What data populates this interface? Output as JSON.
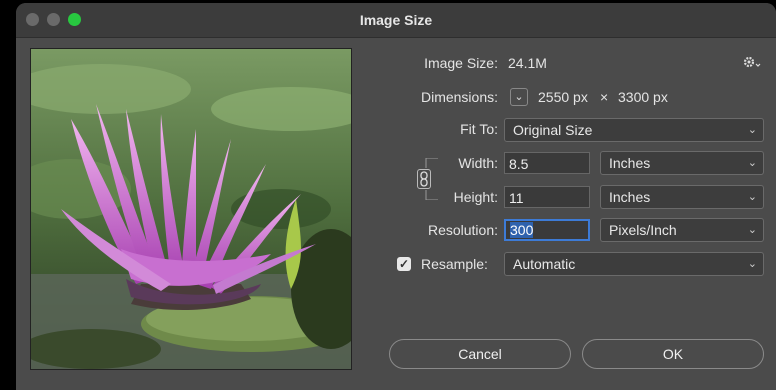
{
  "window": {
    "title": "Image Size"
  },
  "info": {
    "image_size_label": "Image Size:",
    "image_size_value": "24.1M",
    "dimensions_label": "Dimensions:",
    "width_px": "2550 px",
    "times": "×",
    "height_px": "3300 px"
  },
  "fit_to": {
    "label": "Fit To:",
    "value": "Original Size"
  },
  "width": {
    "label": "Width:",
    "value": "8.5",
    "unit": "Inches"
  },
  "height": {
    "label": "Height:",
    "value": "11",
    "unit": "Inches"
  },
  "resolution": {
    "label": "Resolution:",
    "value": "300",
    "unit": "Pixels/Inch"
  },
  "resample": {
    "label": "Resample:",
    "value": "Automatic",
    "checked": true
  },
  "buttons": {
    "cancel": "Cancel",
    "ok": "OK"
  },
  "icons": {
    "gear": "gear-icon",
    "chain": "chain-link-icon",
    "check": "✓",
    "chevron": "⌄"
  }
}
